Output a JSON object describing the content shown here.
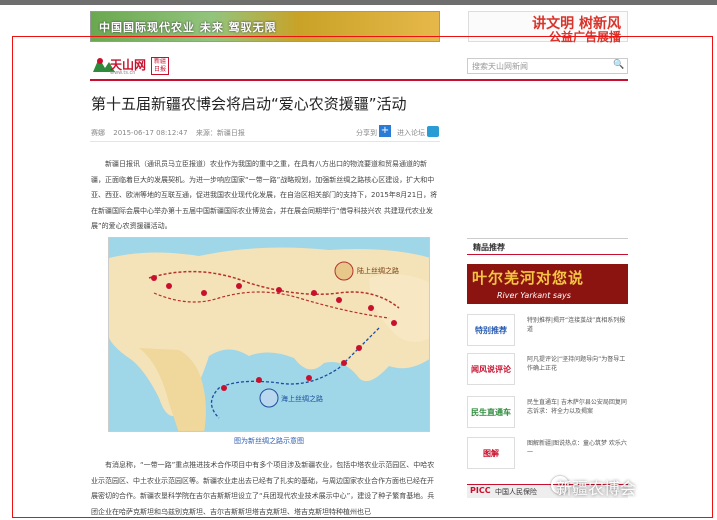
{
  "top_ads": {
    "left_text": "中国国际现代农业 未来 驾驭无限",
    "right_line1": "讲文明 树新风",
    "right_line2": "公益广告展播"
  },
  "site": {
    "logo_name": "天山网",
    "logo_sub": "www.ts.cn",
    "seal_text": "新疆日报"
  },
  "search": {
    "placeholder": "搜索天山网新闻",
    "button": "🔍"
  },
  "article": {
    "title": "第十五届新疆农博会将启动“爱心农资援疆”活动",
    "author": "赛娜",
    "date": "2015-06-17 08:12:47",
    "source": "来源：新疆日报",
    "share_label": "分享到",
    "comment_label": "进入论坛",
    "para1": "新疆日报讯（通讯员马立臣报道）农业作为我国的重中之重，在具有八方出口的物流要道和贸易通道的新疆，正面临着巨大的发展契机。为进一步响应国家“一带一路”战略规划，加强新丝绸之路核心区建设，扩大和中亚、西亚、欧洲等地的互联互通，促进我国农业现代化发展，在自治区相关部门的支持下，2015年8月21日，将在新疆国际会展中心举办第十五届中国新疆国际农业博览会，并在展会同期举行“借导科技兴农 共建现代农业发展”的爱心农资援疆活动。",
    "map_caption": "图为新丝绸之路示意图",
    "map_label_land": "陆上丝绸之路",
    "map_label_sea": "海上丝绸之路",
    "para2": "有消息称，“一带一路”重点推进技术合作项目中有多个项目涉及新疆农业，包括中塔农业示范园区、中哈农业示范园区、中土农业示范园区等。新疆农业走出去已经有了扎实的基础，与周边国家农业合作方面也已经在开展密切的合作。新疆农垦科学院在吉尔吉斯斯坦设立了“兵团现代农业技术展示中心”，建设了种子繁育基地。兵团企业在哈萨克斯坦和乌兹别克斯坦、吉尔吉斯斯坦塔吉克斯坦、塔吉克斯坦特种植州也已"
  },
  "sidebar": {
    "section_title": "精品推荐",
    "promo_cn": "叶尔羌河对您说",
    "promo_en": "River Yarkant says",
    "items": [
      {
        "thumb": "特别推荐",
        "text": "特别推荐|揭开“连接茧战”真相系列报道"
      },
      {
        "thumb": "闻风说评论",
        "text": "阿凡提评论|“坚持问题导向”为督导工作确上正花"
      },
      {
        "thumb": "民生直通车",
        "text": "民生直通车| 吉木萨尔县公安局回复同志诉求：将全力以及揭案"
      },
      {
        "thumb": "图解",
        "text": "图解新疆|图说热点：童心筑梦 欢乐六一"
      }
    ],
    "bottom_ad_logo": "PICC",
    "bottom_ad_text": "中国人民保险"
  },
  "watermark": "新疆农博会",
  "colors": {
    "brand_red": "#c8102e",
    "link_blue": "#2a5db0"
  }
}
